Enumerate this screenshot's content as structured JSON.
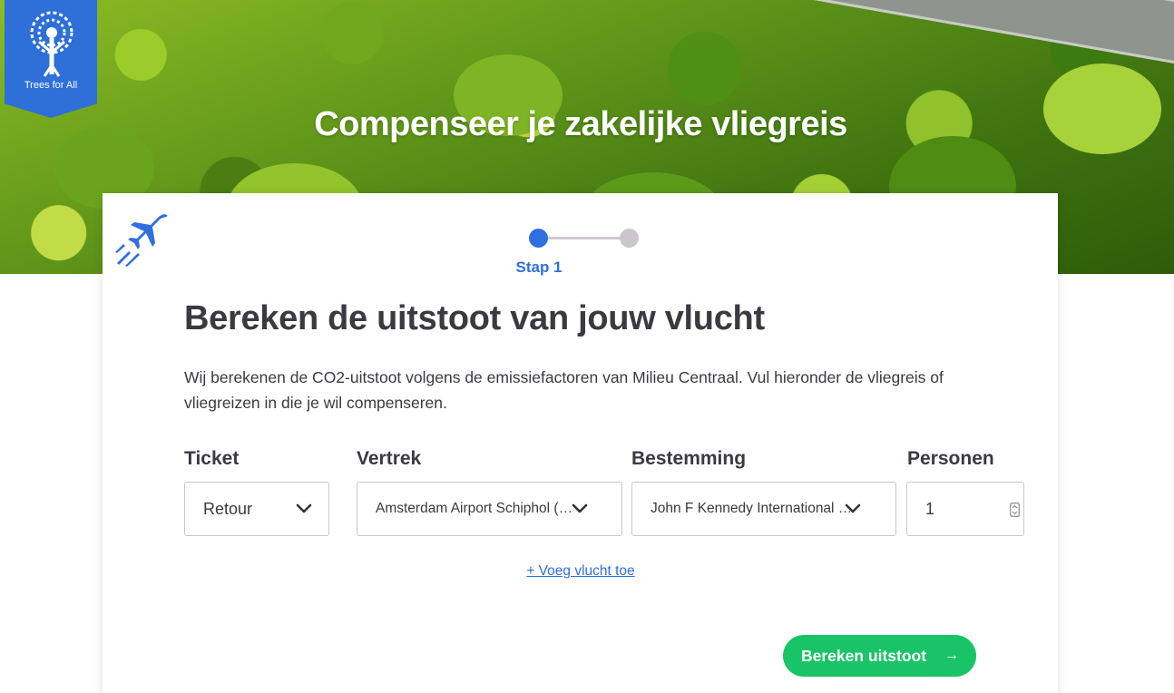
{
  "brand": {
    "name": "Trees for All",
    "logo_icon": "tree-person-icon",
    "color": "#2e6fd8"
  },
  "hero": {
    "title": "Compenseer je zakelijke vliegreis"
  },
  "stepper": {
    "current_label": "Stap 1",
    "current_step": 1,
    "total_steps": 2
  },
  "form": {
    "heading": "Bereken de uitstoot van jouw vlucht",
    "intro": "Wij berekenen de CO2-uitstoot volgens de emissiefactoren van Milieu Centraal. Vul hieronder de vliegreis of vliegreizen in die je wil compenseren.",
    "ticket": {
      "label": "Ticket",
      "value": "Retour"
    },
    "departure": {
      "label": "Vertrek",
      "value": "Amsterdam Airport Schiphol (…"
    },
    "destination": {
      "label": "Bestemming",
      "value": "John F Kennedy International …"
    },
    "persons": {
      "label": "Personen",
      "value": "1"
    },
    "add_flight": "+ Voeg vlucht toe",
    "submit": {
      "label": "Bereken uitstoot",
      "icon": "arrow-right-icon"
    }
  },
  "colors": {
    "accent": "#2f6fe0",
    "button": "#18c466",
    "text": "#3a3a42"
  }
}
